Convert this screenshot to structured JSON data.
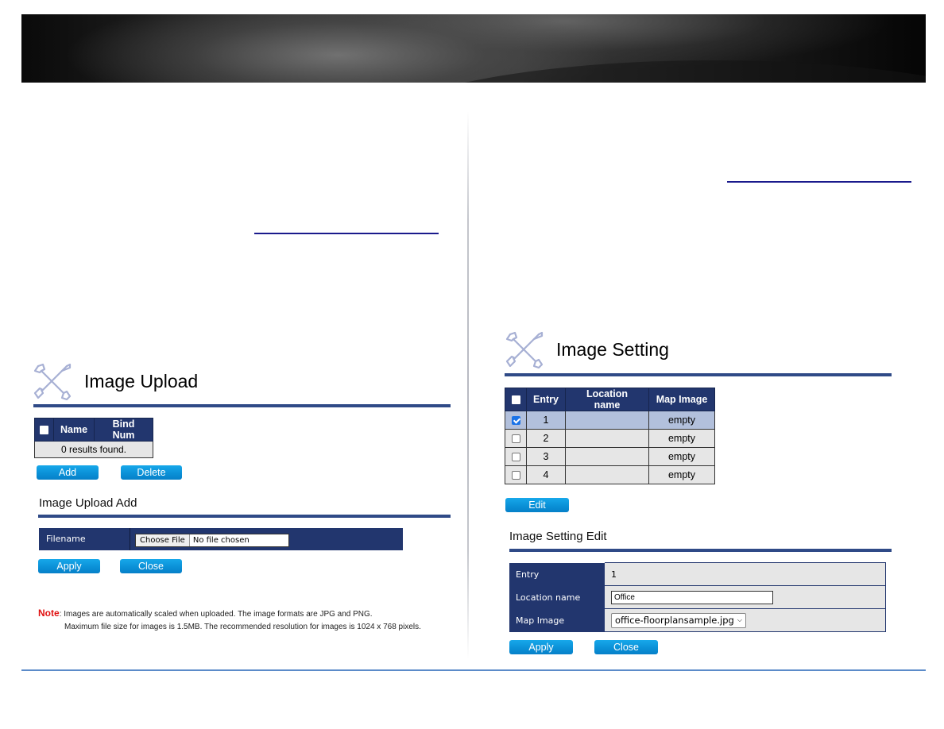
{
  "left_panel": {
    "title": "Image Upload",
    "list_table": {
      "headers": [
        "Name",
        "Bind Num"
      ],
      "empty_message": "0 results found."
    },
    "buttons": {
      "add": "Add",
      "delete": "Delete"
    },
    "add_section": {
      "title": "Image Upload Add",
      "filename_label": "Filename",
      "choose_file_label": "Choose File",
      "file_status": "No file chosen",
      "apply": "Apply",
      "close": "Close"
    },
    "note": {
      "label": "Note",
      "line1": ": Images are automatically scaled when uploaded. The image formats are JPG and PNG.",
      "line2": "Maximum file size for images is 1.5MB. The recommended resolution for images is 1024 x 768 pixels."
    }
  },
  "right_panel": {
    "title": "Image Setting",
    "table": {
      "headers": [
        "Entry",
        "Location name",
        "Map Image"
      ],
      "rows": [
        {
          "checked": true,
          "entry": "1",
          "location": "",
          "map_image": "empty"
        },
        {
          "checked": false,
          "entry": "2",
          "location": "",
          "map_image": "empty"
        },
        {
          "checked": false,
          "entry": "3",
          "location": "",
          "map_image": "empty"
        },
        {
          "checked": false,
          "entry": "4",
          "location": "",
          "map_image": "empty"
        }
      ]
    },
    "edit_button": "Edit",
    "edit_section": {
      "title": "Image Setting Edit",
      "entry_label": "Entry",
      "entry_value": "1",
      "location_label": "Location name",
      "location_value": "Office",
      "map_image_label": "Map Image",
      "map_image_selected": "office-floorplansample.jpg",
      "apply": "Apply",
      "close": "Close"
    }
  },
  "colors": {
    "header_navy": "#22366e",
    "rule_navy": "#2f4a87",
    "button_blue": "#0a8fd6",
    "selected_row": "#b2c0dc",
    "note_red": "#e01010",
    "footer_line": "#5b8bc9"
  }
}
